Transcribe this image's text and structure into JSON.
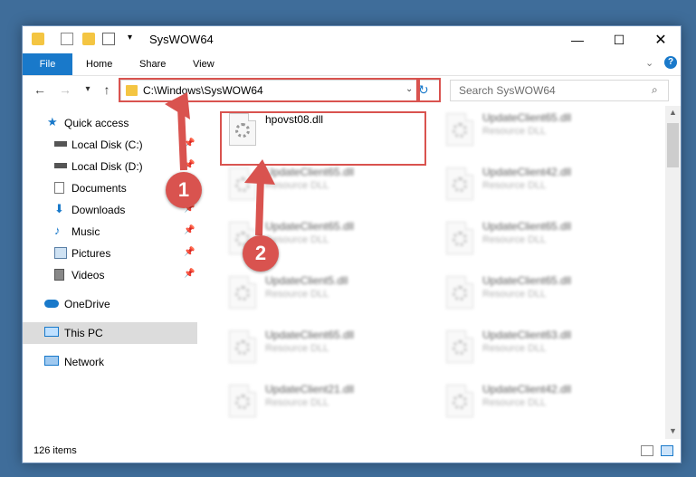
{
  "window": {
    "title": "SysWOW64"
  },
  "ribbon": {
    "tabs": [
      {
        "label": "File"
      },
      {
        "label": "Home"
      },
      {
        "label": "Share"
      },
      {
        "label": "View"
      }
    ]
  },
  "address": {
    "path": "C:\\Windows\\SysWOW64"
  },
  "search": {
    "placeholder": "Search SysWOW64"
  },
  "sidebar": {
    "items": [
      {
        "label": "Quick access",
        "icon": "star-icon"
      },
      {
        "label": "Local Disk (C:)",
        "icon": "drive-icon"
      },
      {
        "label": "Local Disk (D:)",
        "icon": "drive-icon"
      },
      {
        "label": "Documents",
        "icon": "documents-icon"
      },
      {
        "label": "Downloads",
        "icon": "downloads-icon"
      },
      {
        "label": "Music",
        "icon": "music-icon"
      },
      {
        "label": "Pictures",
        "icon": "pictures-icon"
      },
      {
        "label": "Videos",
        "icon": "videos-icon"
      },
      {
        "label": "OneDrive",
        "icon": "cloud-icon"
      },
      {
        "label": "This PC",
        "icon": "computer-icon"
      },
      {
        "label": "Network",
        "icon": "network-icon"
      }
    ]
  },
  "files": [
    {
      "name": "hpovst08.dll",
      "type": ""
    },
    {
      "name": "UpdateClient65.dll",
      "type": "Resource DLL"
    },
    {
      "name": "UpdateClient65.dll",
      "type": "Resource DLL"
    },
    {
      "name": "UpdateClient42.dll",
      "type": "Resource DLL"
    },
    {
      "name": "UpdateClient65.dll",
      "type": "Resource DLL"
    },
    {
      "name": "UpdateClient65.dll",
      "type": "Resource DLL"
    },
    {
      "name": "UpdateClient5.dll",
      "type": "Resource DLL"
    },
    {
      "name": "UpdateClient65.dll",
      "type": "Resource DLL"
    },
    {
      "name": "UpdateClient65.dll",
      "type": "Resource DLL"
    },
    {
      "name": "UpdateClient63.dll",
      "type": "Resource DLL"
    },
    {
      "name": "UpdateClient21.dll",
      "type": "Resource DLL"
    },
    {
      "name": "UpdateClient42.dll",
      "type": "Resource DLL"
    }
  ],
  "status": {
    "count": "126 items"
  },
  "callouts": {
    "one": "1",
    "two": "2"
  },
  "colors": {
    "accent": "#1979ca",
    "callout": "#d9534f",
    "selection": "#dcdcdc"
  }
}
